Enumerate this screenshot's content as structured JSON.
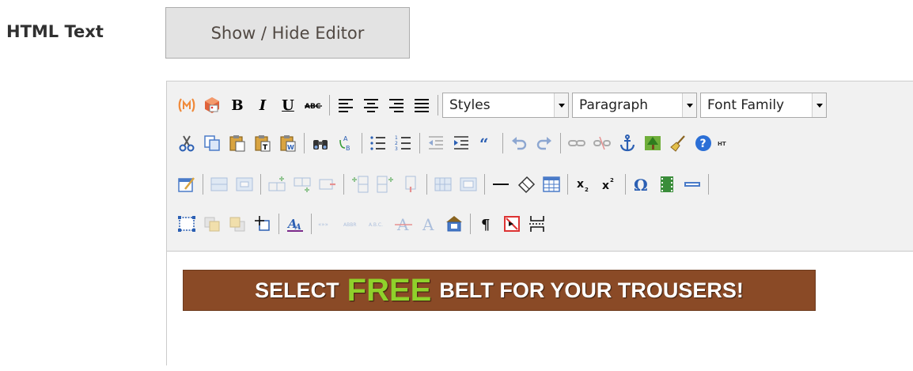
{
  "field": {
    "label": "HTML Text",
    "toggle_label": "Show / Hide Editor"
  },
  "toolbar": {
    "styles_label": "Styles",
    "format_label": "Paragraph",
    "font_family_label": "Font Family"
  },
  "content": {
    "banner_before": "SELECT",
    "banner_highlight": "FREE",
    "banner_after": "BELT FOR YOUR TROUSERS!"
  },
  "colors": {
    "banner_bg": "#8a4a26",
    "banner_highlight": "#8fd12b",
    "button_bg": "#e3e3e3"
  }
}
